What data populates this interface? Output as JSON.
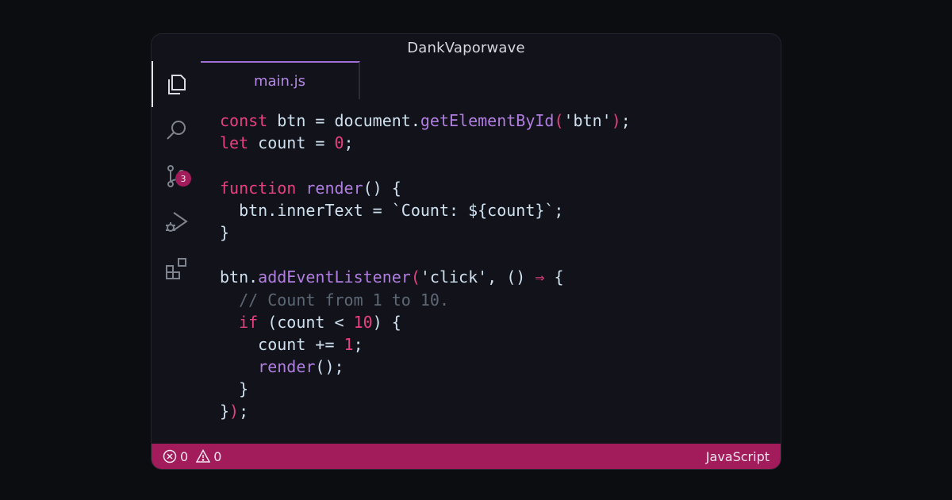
{
  "window": {
    "title": "DankVaporwave"
  },
  "activity_bar": {
    "items": [
      {
        "icon": "files-icon",
        "active": true
      },
      {
        "icon": "search-icon"
      },
      {
        "icon": "source-control-icon",
        "badge": "3"
      },
      {
        "icon": "run-debug-icon"
      },
      {
        "icon": "extensions-icon"
      }
    ]
  },
  "tabs": [
    {
      "label": "main.js",
      "active": true
    }
  ],
  "editor": {
    "language": "JavaScript",
    "lines": [
      [
        {
          "t": "const",
          "c": "kw"
        },
        {
          "t": " btn = document.",
          "c": "pl"
        },
        {
          "t": "getElementById",
          "c": "fn"
        },
        {
          "t": "(",
          "c": "br"
        },
        {
          "t": "'btn'",
          "c": "str"
        },
        {
          "t": ")",
          "c": "br"
        },
        {
          "t": ";",
          "c": "pl"
        }
      ],
      [
        {
          "t": "let",
          "c": "kw"
        },
        {
          "t": " count = ",
          "c": "pl"
        },
        {
          "t": "0",
          "c": "num"
        },
        {
          "t": ";",
          "c": "pl"
        }
      ],
      [],
      [
        {
          "t": "function",
          "c": "kw"
        },
        {
          "t": " ",
          "c": "pl"
        },
        {
          "t": "render",
          "c": "fn"
        },
        {
          "t": "() {",
          "c": "pl"
        }
      ],
      [
        {
          "t": "  btn.innerText = `Count: ${count}`;",
          "c": "pl"
        }
      ],
      [
        {
          "t": "}",
          "c": "pl"
        }
      ],
      [],
      [
        {
          "t": "btn.",
          "c": "pl"
        },
        {
          "t": "addEventListener",
          "c": "fn"
        },
        {
          "t": "(",
          "c": "br"
        },
        {
          "t": "'click', () ",
          "c": "pl"
        },
        {
          "t": "⇒",
          "c": "kw"
        },
        {
          "t": " {",
          "c": "pl"
        }
      ],
      [
        {
          "t": "  // Count from 1 to 10.",
          "c": "cm"
        }
      ],
      [
        {
          "t": "  ",
          "c": "pl"
        },
        {
          "t": "if",
          "c": "kw"
        },
        {
          "t": " (count < ",
          "c": "pl"
        },
        {
          "t": "10",
          "c": "num"
        },
        {
          "t": ") {",
          "c": "pl"
        }
      ],
      [
        {
          "t": "    count += ",
          "c": "pl"
        },
        {
          "t": "1",
          "c": "num"
        },
        {
          "t": ";",
          "c": "pl"
        }
      ],
      [
        {
          "t": "    ",
          "c": "pl"
        },
        {
          "t": "render",
          "c": "fn"
        },
        {
          "t": "();",
          "c": "pl"
        }
      ],
      [
        {
          "t": "  }",
          "c": "pl"
        }
      ],
      [
        {
          "t": "}",
          "c": "pl"
        },
        {
          "t": ")",
          "c": "br"
        },
        {
          "t": ";",
          "c": "pl"
        }
      ]
    ]
  },
  "status_bar": {
    "errors": "0",
    "warnings": "0",
    "language": "JavaScript"
  },
  "colors": {
    "accent": "#a21c5c",
    "keyword": "#e6407f",
    "function": "#b07ee0",
    "comment": "#5d6874",
    "text": "#cfe0ee"
  }
}
